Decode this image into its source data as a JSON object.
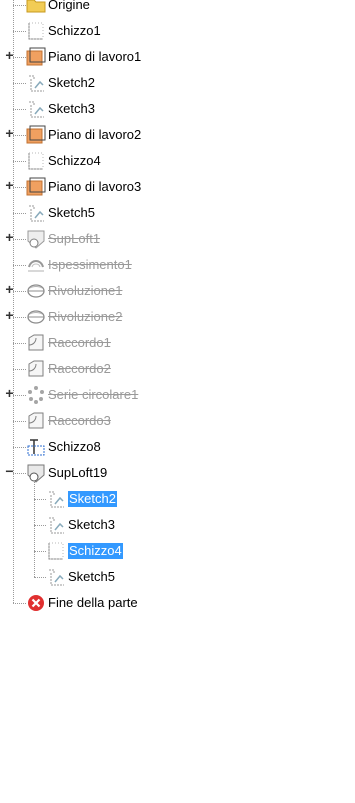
{
  "tree": {
    "items": [
      {
        "label": "Origine",
        "icon": "origin-folder-icon",
        "level": 0,
        "expander": "",
        "state": "normal"
      },
      {
        "label": "Schizzo1",
        "icon": "sketch-empty-icon",
        "level": 0,
        "expander": "",
        "state": "normal"
      },
      {
        "label": "Piano di lavoro1",
        "icon": "work-plane-icon",
        "level": 0,
        "expander": "+",
        "state": "normal"
      },
      {
        "label": "Sketch2",
        "icon": "sketch-icon",
        "level": 0,
        "expander": "",
        "state": "normal"
      },
      {
        "label": "Sketch3",
        "icon": "sketch-icon",
        "level": 0,
        "expander": "",
        "state": "normal"
      },
      {
        "label": "Piano di lavoro2",
        "icon": "work-plane-icon",
        "level": 0,
        "expander": "+",
        "state": "normal"
      },
      {
        "label": "Schizzo4",
        "icon": "sketch-empty-icon",
        "level": 0,
        "expander": "",
        "state": "normal"
      },
      {
        "label": "Piano di lavoro3",
        "icon": "work-plane-icon",
        "level": 0,
        "expander": "+",
        "state": "normal"
      },
      {
        "label": "Sketch5",
        "icon": "sketch-icon",
        "level": 0,
        "expander": "",
        "state": "normal"
      },
      {
        "label": "SupLoft1",
        "icon": "loft-icon",
        "level": 0,
        "expander": "+",
        "state": "suppressed"
      },
      {
        "label": "Ispessimento1",
        "icon": "thicken-icon",
        "level": 0,
        "expander": "",
        "state": "suppressed"
      },
      {
        "label": "Rivoluzione1",
        "icon": "revolve-icon",
        "level": 0,
        "expander": "+",
        "state": "suppressed"
      },
      {
        "label": "Rivoluzione2",
        "icon": "revolve-icon",
        "level": 0,
        "expander": "+",
        "state": "suppressed"
      },
      {
        "label": "Raccordo1",
        "icon": "fillet-icon",
        "level": 0,
        "expander": "",
        "state": "suppressed"
      },
      {
        "label": "Raccordo2",
        "icon": "fillet-icon",
        "level": 0,
        "expander": "",
        "state": "suppressed"
      },
      {
        "label": "Serie circolare1",
        "icon": "circular-pattern-icon",
        "level": 0,
        "expander": "+",
        "state": "suppressed"
      },
      {
        "label": "Raccordo3",
        "icon": "fillet-icon",
        "level": 0,
        "expander": "",
        "state": "suppressed"
      },
      {
        "label": "Schizzo8",
        "icon": "sketch-blue-icon",
        "level": 0,
        "expander": "",
        "state": "normal"
      },
      {
        "label": "SupLoft19",
        "icon": "loft-icon",
        "level": 0,
        "expander": "−",
        "state": "normal"
      },
      {
        "label": "Sketch2",
        "icon": "sketch-icon",
        "level": 1,
        "expander": "",
        "state": "selected"
      },
      {
        "label": "Sketch3",
        "icon": "sketch-icon",
        "level": 1,
        "expander": "",
        "state": "normal"
      },
      {
        "label": "Schizzo4",
        "icon": "sketch-empty-icon",
        "level": 1,
        "expander": "",
        "state": "selected"
      },
      {
        "label": "Sketch5",
        "icon": "sketch-icon",
        "level": 1,
        "expander": "",
        "state": "normal"
      },
      {
        "label": "Fine della parte",
        "icon": "end-of-part-icon",
        "level": 0,
        "expander": "",
        "state": "normal"
      }
    ]
  },
  "colors": {
    "selection": "#3399ff",
    "suppressed_text": "#9a9a9a",
    "plane_orange": "#f0a060",
    "end_red": "#e03030"
  }
}
